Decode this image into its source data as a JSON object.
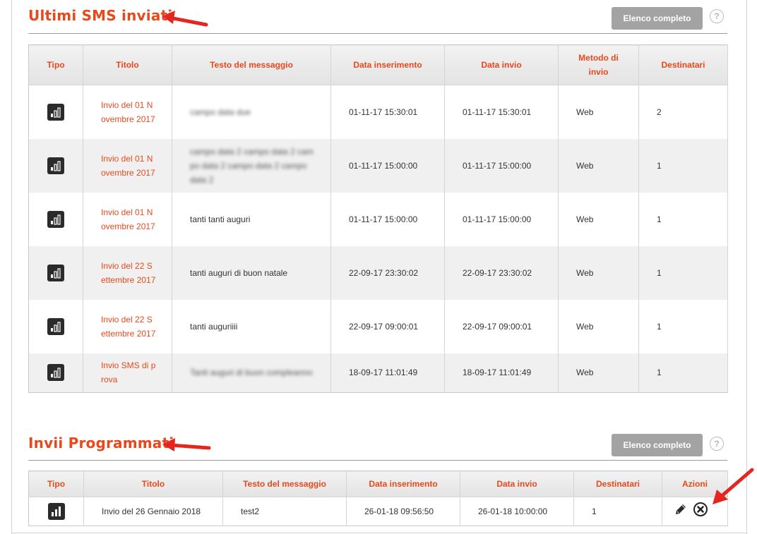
{
  "section1": {
    "title": "Ultimi SMS inviati",
    "button_label": "Elenco completo",
    "help_label": "?",
    "headers": {
      "tipo": "Tipo",
      "titolo": "Titolo",
      "testo": "Testo del messaggio",
      "data_inserimento": "Data inserimento",
      "data_invio": "Data invio",
      "metodo": "Metodo di invio",
      "destinatari": "Destinatari"
    },
    "rows": [
      {
        "tipo_icon": "chart-icon",
        "titolo": "Invio del 01 Novembre 2017",
        "testo": "campo data due",
        "testo_blurred": true,
        "data_inserimento": "01-11-17 15:30:01",
        "data_invio": "01-11-17 15:30:01",
        "metodo": "Web",
        "destinatari": "2"
      },
      {
        "tipo_icon": "chart-icon",
        "titolo": "Invio del 01 Novembre 2017",
        "testo": "campo data 2 campo data 2 campo data 2 campo data 2 campo data 2",
        "testo_blurred": true,
        "data_inserimento": "01-11-17 15:00:00",
        "data_invio": "01-11-17 15:00:00",
        "metodo": "Web",
        "destinatari": "1"
      },
      {
        "tipo_icon": "chart-icon",
        "titolo": "Invio del 01 Novembre 2017",
        "testo": "tanti tanti auguri",
        "testo_blurred": false,
        "data_inserimento": "01-11-17 15:00:00",
        "data_invio": "01-11-17 15:00:00",
        "metodo": "Web",
        "destinatari": "1"
      },
      {
        "tipo_icon": "chart-icon",
        "titolo": "Invio del 22 Settembre 2017",
        "testo": "tanti auguri di buon natale",
        "testo_blurred": false,
        "data_inserimento": "22-09-17 23:30:02",
        "data_invio": "22-09-17 23:30:02",
        "metodo": "Web",
        "destinatari": "1"
      },
      {
        "tipo_icon": "chart-icon",
        "titolo": "Invio del 22 Settembre 2017",
        "testo": "tanti auguriiii",
        "testo_blurred": false,
        "data_inserimento": "22-09-17 09:00:01",
        "data_invio": "22-09-17 09:00:01",
        "metodo": "Web",
        "destinatari": "1"
      },
      {
        "tipo_icon": "chart-icon",
        "titolo": "Invio SMS di prova",
        "testo": "Tanti auguri di buon compleanno",
        "testo_blurred": true,
        "data_inserimento": "18-09-17 11:01:49",
        "data_invio": "18-09-17 11:01:49",
        "metodo": "Web",
        "destinatari": "1"
      }
    ]
  },
  "section2": {
    "title": "Invii Programmati",
    "button_label": "Elenco completo",
    "help_label": "?",
    "headers": {
      "tipo": "Tipo",
      "titolo": "Titolo",
      "testo": "Testo del messaggio",
      "data_inserimento": "Data inserimento",
      "data_invio": "Data invio",
      "destinatari": "Destinatari",
      "azioni": "Azioni"
    },
    "rows": [
      {
        "tipo_icon": "chart-icon",
        "titolo": "Invio del 26 Gennaio 2018",
        "testo": "test2",
        "data_inserimento": "26-01-18 09:56:50",
        "data_invio": "26-01-18 10:00:00",
        "destinatari": "1",
        "actions": [
          "edit-icon",
          "delete-icon"
        ]
      }
    ]
  },
  "colors": {
    "accent": "#e8491c",
    "arrow": "#e3261f",
    "button": "#a3a3a3",
    "row_alt": "#f0f0f0"
  }
}
